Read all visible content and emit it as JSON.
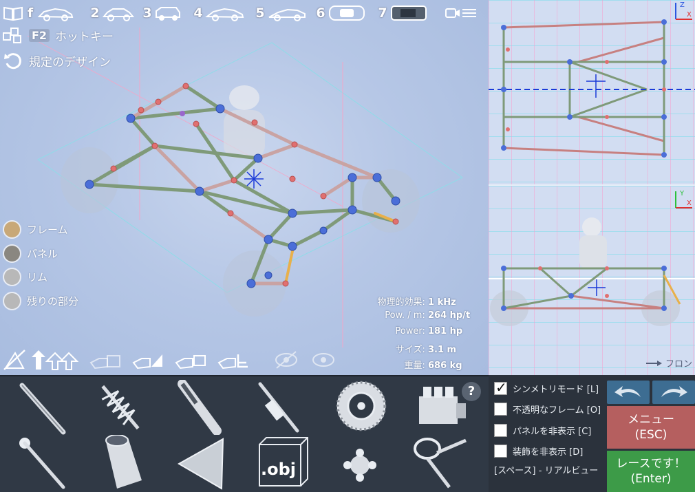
{
  "car_slots": [
    {
      "num": "f",
      "icon": "car-sport-icon"
    },
    {
      "num": "2",
      "icon": "car-sedan-icon"
    },
    {
      "num": "3",
      "icon": "car-suv-icon"
    },
    {
      "num": "4",
      "icon": "car-coupe-icon"
    },
    {
      "num": "5",
      "icon": "car-coupe-icon"
    },
    {
      "num": "6",
      "icon": "car-top-icon"
    },
    {
      "num": "7",
      "icon": "car-top-dark-icon"
    }
  ],
  "camera_menu_icon": "camera-menu-icon",
  "left_menu": {
    "hotkey_badge": "F2",
    "hotkey_label": "ホットキー",
    "default_design_label": "規定のデザイン"
  },
  "legend": [
    {
      "label": "フレーム",
      "color": "#c8a878"
    },
    {
      "label": "パネル",
      "color": "#8a8780"
    },
    {
      "label": "リム",
      "color": "#b8b8b8"
    },
    {
      "label": "残りの部分",
      "color": "#b8b8b8"
    }
  ],
  "stats": [
    {
      "label": "物理的効果:",
      "value": "1 kHz"
    },
    {
      "label": "Pow. / m:",
      "value": "264 hp/t"
    },
    {
      "label": "Power:",
      "value": "181 hp"
    },
    {
      "label": "サイズ:",
      "value": "3.1 m"
    },
    {
      "label": "重量:",
      "value": "686 kg"
    }
  ],
  "side_view": {
    "front_label": "フロン",
    "top_axes": [
      "Z",
      "X"
    ],
    "side_axes": [
      "Y",
      "X"
    ]
  },
  "parts": [
    {
      "name": "beam",
      "icon": "beam-icon"
    },
    {
      "name": "spring",
      "icon": "spring-icon"
    },
    {
      "name": "damper",
      "icon": "damper-icon"
    },
    {
      "name": "hydraulic",
      "icon": "hydraulic-icon"
    },
    {
      "name": "wheel",
      "icon": "wheel-icon"
    },
    {
      "name": "engine",
      "icon": "engine-icon"
    },
    {
      "name": "rod",
      "icon": "rod-icon"
    },
    {
      "name": "jet",
      "icon": "jet-nozzle-icon"
    },
    {
      "name": "panel",
      "icon": "triangle-panel-icon"
    },
    {
      "name": "obj",
      "label": ".obj"
    },
    {
      "name": "joint",
      "icon": "joint-icon"
    },
    {
      "name": "steering",
      "icon": "steering-icon"
    }
  ],
  "help_label": "?",
  "options": [
    {
      "label": "シンメトリモード [L]",
      "checked": true
    },
    {
      "label": "不透明なフレーム [O]",
      "checked": false
    },
    {
      "label": "パネルを非表示 [C]",
      "checked": false
    },
    {
      "label": "装飾を非表示 [D]",
      "checked": false
    }
  ],
  "realview_label": "[スペース] - リアルビュー",
  "menu_button": {
    "line1": "メニュー",
    "line2": "(ESC)"
  },
  "race_button": {
    "line1": "レースです！",
    "line2": "(Enter)"
  },
  "colors": {
    "menu": "#b55f5f",
    "race": "#3d9b48",
    "arrow": "#3d6d92",
    "panel_bg": "#303945"
  }
}
